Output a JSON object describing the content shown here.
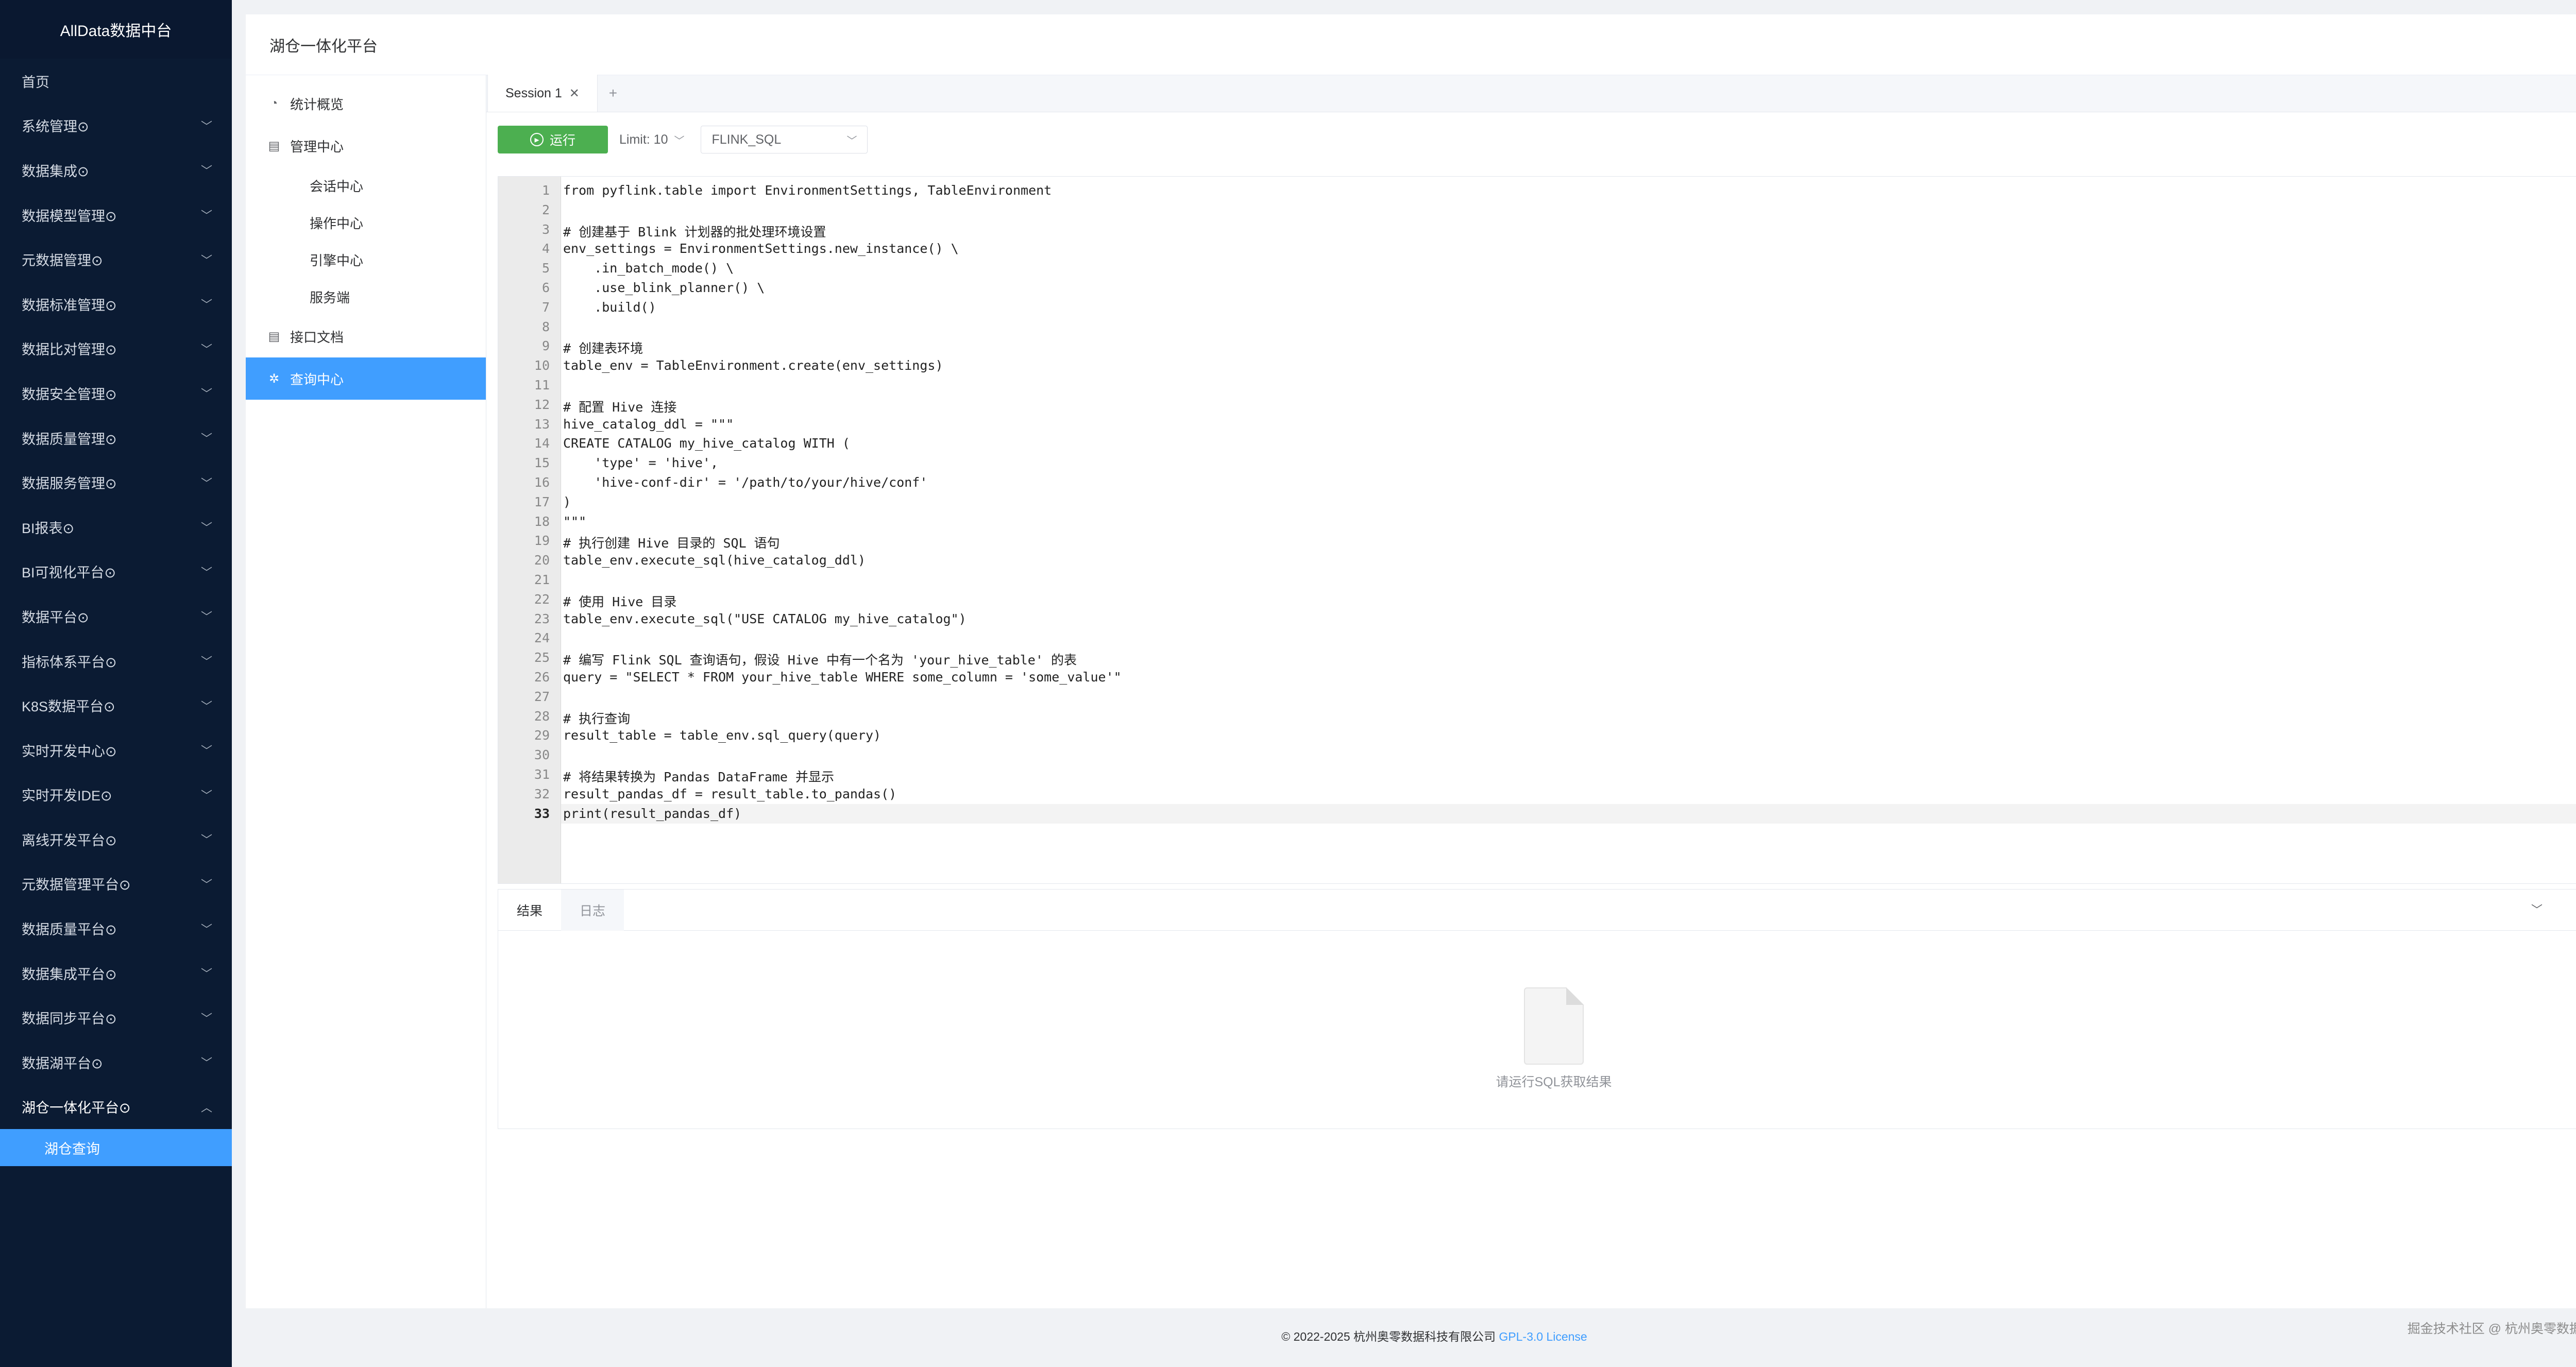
{
  "sidebar": {
    "brand": "AllData数据中台",
    "items": [
      {
        "label": "首页",
        "chevron": false
      },
      {
        "label": "系统管理⊙",
        "chevron": true
      },
      {
        "label": "数据集成⊙",
        "chevron": true
      },
      {
        "label": "数据模型管理⊙",
        "chevron": true
      },
      {
        "label": "元数据管理⊙",
        "chevron": true
      },
      {
        "label": "数据标准管理⊙",
        "chevron": true
      },
      {
        "label": "数据比对管理⊙",
        "chevron": true
      },
      {
        "label": "数据安全管理⊙",
        "chevron": true
      },
      {
        "label": "数据质量管理⊙",
        "chevron": true
      },
      {
        "label": "数据服务管理⊙",
        "chevron": true
      },
      {
        "label": "BI报表⊙",
        "chevron": true
      },
      {
        "label": "BI可视化平台⊙",
        "chevron": true
      },
      {
        "label": "数据平台⊙",
        "chevron": true
      },
      {
        "label": "指标体系平台⊙",
        "chevron": true
      },
      {
        "label": "K8S数据平台⊙",
        "chevron": true
      },
      {
        "label": "实时开发中心⊙",
        "chevron": true
      },
      {
        "label": "实时开发IDE⊙",
        "chevron": true
      },
      {
        "label": "离线开发平台⊙",
        "chevron": true
      },
      {
        "label": "元数据管理平台⊙",
        "chevron": true
      },
      {
        "label": "数据质量平台⊙",
        "chevron": true
      },
      {
        "label": "数据集成平台⊙",
        "chevron": true
      },
      {
        "label": "数据同步平台⊙",
        "chevron": true
      },
      {
        "label": "数据湖平台⊙",
        "chevron": true
      }
    ],
    "open_item": "湖仓一体化平台⊙",
    "open_sub": "湖仓查询"
  },
  "page_title": "湖仓一体化平台",
  "subnav": {
    "stats": "统计概览",
    "manage": "管理中心",
    "manage_children": [
      "会话中心",
      "操作中心",
      "引擎中心",
      "服务端"
    ],
    "api_docs": "接口文档",
    "query": "查询中心"
  },
  "session_tab": "Session 1",
  "toolbar": {
    "run_label": "运行",
    "limit_label": "Limit: 10",
    "engine": "FLINK_SQL"
  },
  "code_lines": [
    "from pyflink.table import EnvironmentSettings, TableEnvironment",
    "",
    "# 创建基于 Blink 计划器的批处理环境设置",
    "env_settings = EnvironmentSettings.new_instance() \\",
    "    .in_batch_mode() \\",
    "    .use_blink_planner() \\",
    "    .build()",
    "",
    "# 创建表环境",
    "table_env = TableEnvironment.create(env_settings)",
    "",
    "# 配置 Hive 连接",
    "hive_catalog_ddl = \"\"\"",
    "CREATE CATALOG my_hive_catalog WITH (",
    "    'type' = 'hive',",
    "    'hive-conf-dir' = '/path/to/your/hive/conf'",
    ")",
    "\"\"\"",
    "# 执行创建 Hive 目录的 SQL 语句",
    "table_env.execute_sql(hive_catalog_ddl)",
    "",
    "# 使用 Hive 目录",
    "table_env.execute_sql(\"USE CATALOG my_hive_catalog\")",
    "",
    "# 编写 Flink SQL 查询语句，假设 Hive 中有一个名为 'your_hive_table' 的表",
    "query = \"SELECT * FROM your_hive_table WHERE some_column = 'some_value'\"",
    "",
    "# 执行查询",
    "result_table = table_env.sql_query(query)",
    "",
    "# 将结果转换为 Pandas DataFrame 并显示",
    "result_pandas_df = result_table.to_pandas()",
    "print(result_pandas_df)"
  ],
  "current_line": 33,
  "results": {
    "tab_result": "结果",
    "tab_log": "日志",
    "empty_text": "请运行SQL获取结果"
  },
  "footer": {
    "copyright": "© 2022-2025 杭州奥零数据科技有限公司 ",
    "license": "GPL-3.0 License"
  },
  "watermark": "掘金技术社区 @ 杭州奥零数据科技",
  "colors": {
    "sidebar_bg": "#0b1b33",
    "accent": "#409eff",
    "run_button": "#4caf50"
  },
  "icons": {
    "stats": "dashboard-icon",
    "manage": "clipboard-icon",
    "api_docs": "clipboard-icon",
    "query": "gear-icon",
    "run": "play-circle-icon",
    "close": "close-icon",
    "add": "plus-icon",
    "chevron": "chevron-down-icon"
  }
}
